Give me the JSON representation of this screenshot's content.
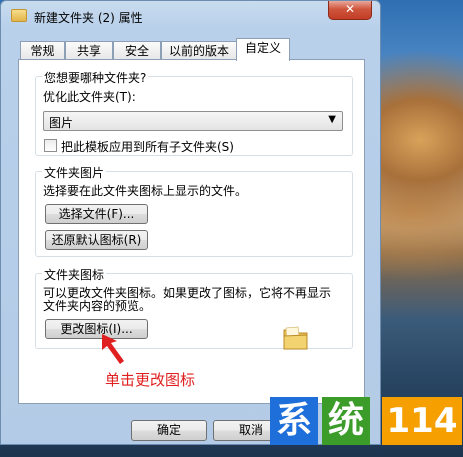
{
  "window": {
    "title": "新建文件夹 (2) 属性",
    "close_label": "✕"
  },
  "tabs": [
    {
      "label": "常规"
    },
    {
      "label": "共享"
    },
    {
      "label": "安全"
    },
    {
      "label": "以前的版本"
    },
    {
      "label": "自定义",
      "active": true
    }
  ],
  "folder_type": {
    "group_title": "您想要哪种文件夹?",
    "optimize_label": "优化此文件夹(T):",
    "selected_value": "图片",
    "apply_checkbox_label": "把此模板应用到所有子文件夹(S)",
    "apply_checked": false
  },
  "folder_picture": {
    "group_title": "文件夹图片",
    "description": "选择要在此文件夹图标上显示的文件。",
    "choose_file_button": "选择文件(F)...",
    "restore_default_button": "还原默认图标(R)"
  },
  "folder_icon": {
    "group_title": "文件夹图标",
    "description_line1": "可以更改文件夹图标。如果更改了图标，它将不再显示",
    "description_line2": "文件夹内容的预览。",
    "change_icon_button": "更改图标(I)..."
  },
  "footer": {
    "ok_button": "确定",
    "cancel_button": "取消"
  },
  "annotation": {
    "text": "单击更改图标"
  },
  "watermark": {
    "char1": "系",
    "char2": "统",
    "number": "114",
    "colors": {
      "char1_bg": "#1e6fd9",
      "char2_bg": "#3b9c2a",
      "number_bg": "#f5a000"
    }
  }
}
